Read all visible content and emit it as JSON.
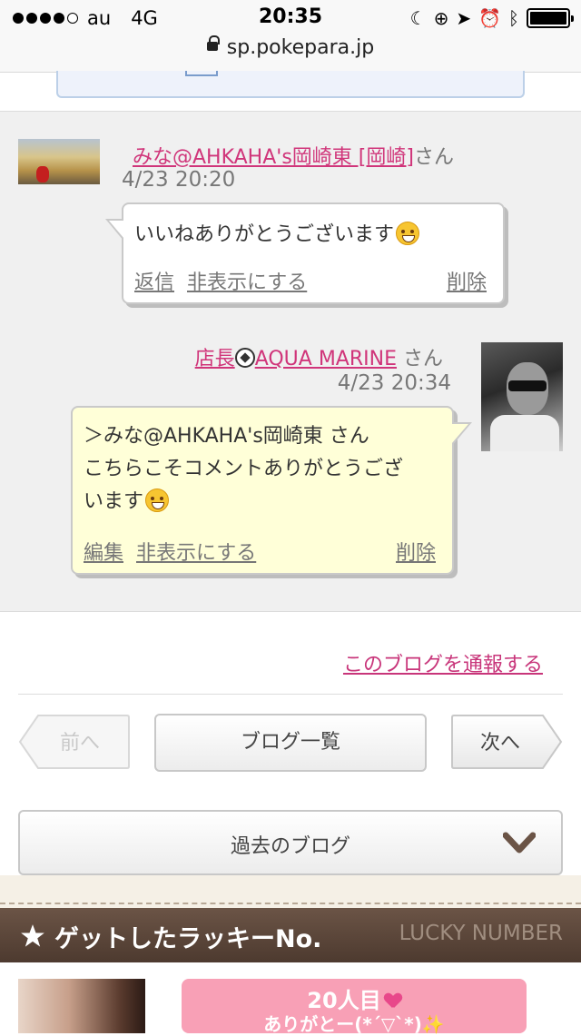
{
  "status_bar": {
    "carrier": "au",
    "network": "4G",
    "time": "20:35",
    "signal_bars": 4
  },
  "url_bar": {
    "domain": "sp.pokepara.jp"
  },
  "comments": [
    {
      "author": "みな@AHKAHA's岡崎東 [岡崎]",
      "suffix": "さん",
      "date": "4/23 20:20",
      "text": "いいねありがとうございます",
      "actions": {
        "reply": "返信",
        "hide": "非表示にする",
        "delete": "削除"
      }
    },
    {
      "author_prefix": "店長",
      "author": "AQUA MARINE",
      "suffix": "さん",
      "date": "4/23 20:34",
      "text_line1": "＞みな@AHKAHA's岡崎東 さん",
      "text_line2": "こちらこそコメントありがとうござ",
      "text_line3": "います",
      "actions": {
        "edit": "編集",
        "hide": "非表示にする",
        "delete": "削除"
      }
    }
  ],
  "report_link": "このブログを通報する",
  "nav": {
    "prev": "前へ",
    "list": "ブログ一覧",
    "next": "次へ"
  },
  "past_blogs": "過去のブログ",
  "lucky_section": {
    "title": "ゲットしたラッキーNo.",
    "subtitle": "LUCKY NUMBER"
  },
  "lucky_card": {
    "line1": "20人目",
    "line2": "ありがとー(*´▽`*)✨"
  }
}
